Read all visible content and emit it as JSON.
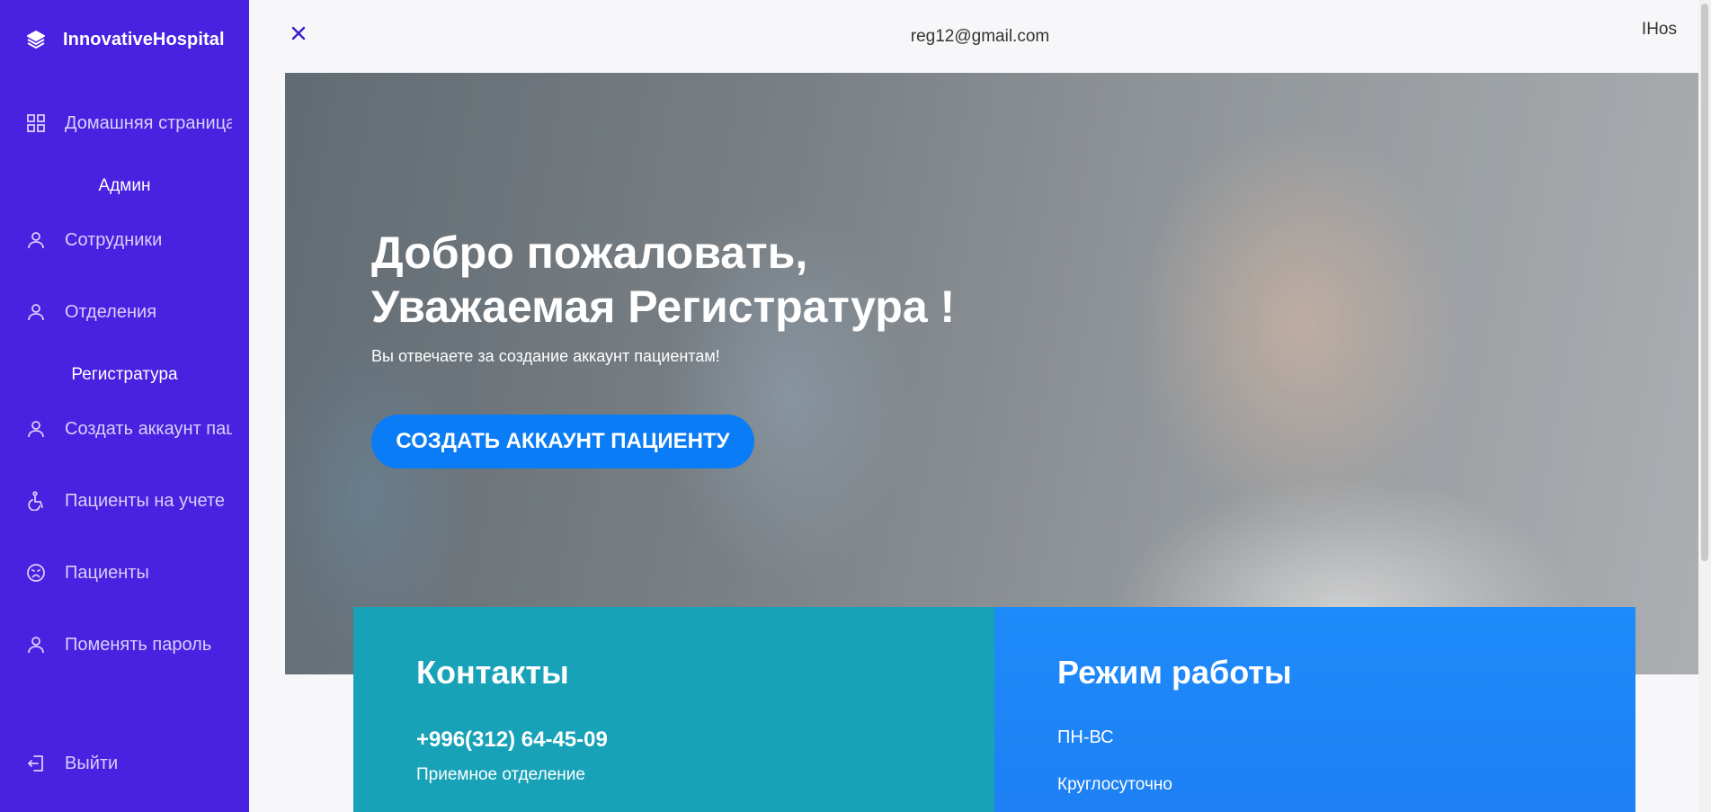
{
  "sidebar": {
    "brand": "InnovativeHospital",
    "items": [
      {
        "label": "Домашняя страница",
        "icon": "grid-icon"
      },
      {
        "label": "Сотрудники",
        "icon": "user-icon"
      },
      {
        "label": "Отделения",
        "icon": "user-icon"
      },
      {
        "label": "Создать аккаунт пациенту",
        "icon": "user-icon"
      },
      {
        "label": "Пациенты на учете",
        "icon": "wheelchair-icon"
      },
      {
        "label": "Пациенты",
        "icon": "sad-face-icon"
      },
      {
        "label": "Поменять пароль",
        "icon": "user-icon"
      },
      {
        "label": "Выйти",
        "icon": "logout-icon"
      }
    ],
    "sections": {
      "admin": "Админ",
      "registry": "Регистратура"
    }
  },
  "topbar": {
    "email": "reg12@gmail.com",
    "brand_short": "IHos"
  },
  "hero": {
    "title_line1": "Добро пожаловать,",
    "title_line2": "Уважаемая Регистратура !",
    "subtitle": "Вы отвечаете за создание аккаунт пациентам!",
    "cta": "СОЗДАТЬ АККАУНТ ПАЦИЕНТУ"
  },
  "contacts": {
    "title": "Контакты",
    "phone": "+996(312) 64-45-09",
    "department": "Приемное отделение"
  },
  "hours": {
    "title": "Режим работы",
    "days": "ПН-ВС",
    "schedule": "Круглосуточно"
  },
  "colors": {
    "sidebar": "#4821e1",
    "cta": "#0a7cf5",
    "contacts_card": "#17a2b8",
    "hours_card": "#1e8bfb"
  }
}
